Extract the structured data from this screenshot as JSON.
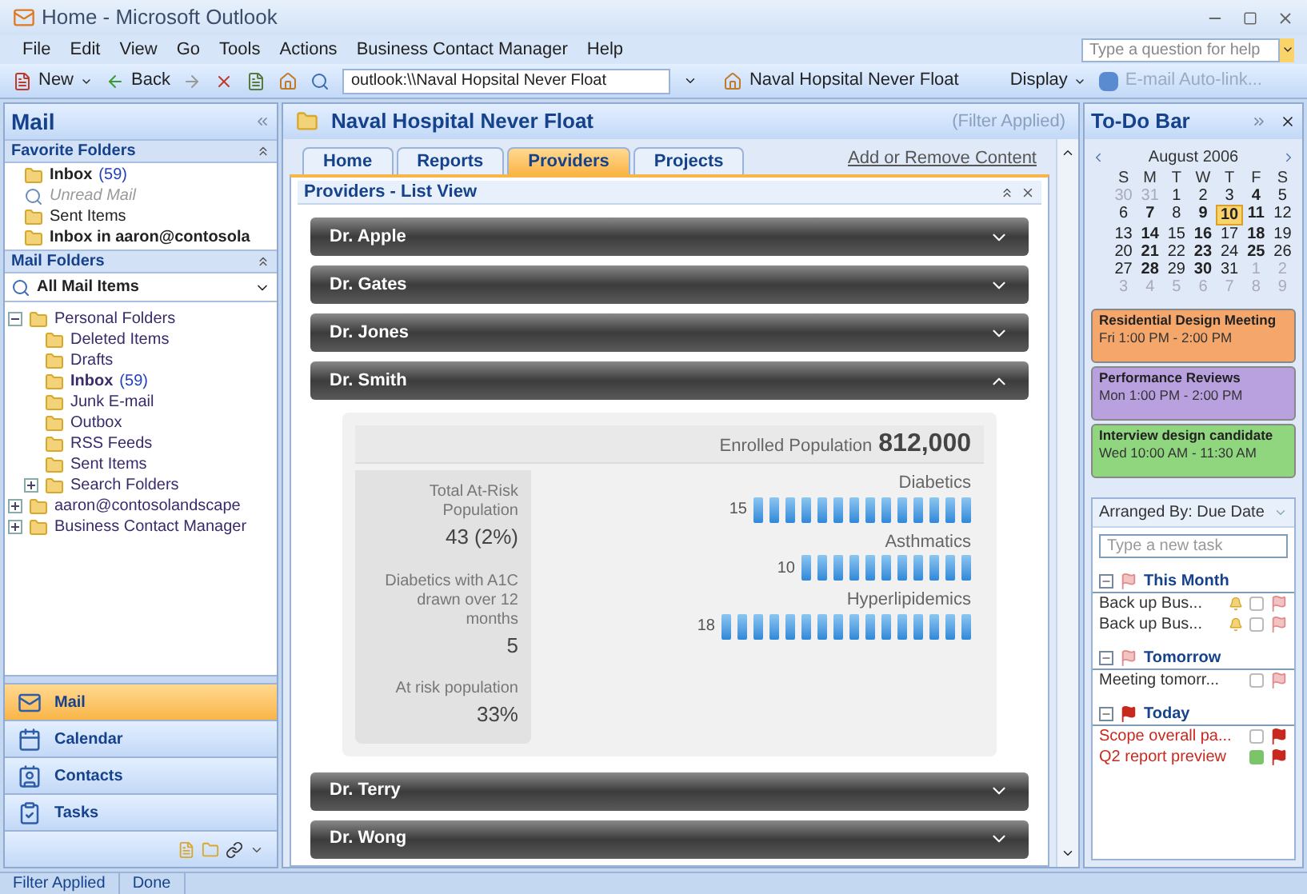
{
  "window": {
    "title": "Home - Microsoft Outlook"
  },
  "menu": [
    "File",
    "Edit",
    "View",
    "Go",
    "Tools",
    "Actions",
    "Business Contact Manager",
    "Help"
  ],
  "help_search": {
    "placeholder": "Type a question for help"
  },
  "toolbar": {
    "new": "New",
    "back": "Back",
    "address": "outlook:\\\\Naval Hopsital Never Float",
    "home_link": "Naval Hopsital Never Float",
    "display": "Display",
    "autolink": {
      "label": "E-mail Auto-link...",
      "disabled": true
    }
  },
  "nav_pane": {
    "title": "Mail",
    "favorites_title": "Favorite Folders",
    "favorites": [
      {
        "label": "Inbox",
        "count": "(59)",
        "kind": "folder",
        "bold": true
      },
      {
        "label": "Unread Mail",
        "kind": "search",
        "bold": false
      },
      {
        "label": "Sent Items",
        "kind": "folder",
        "bold": false
      },
      {
        "label": "Inbox in aaron@contosola",
        "kind": "folder",
        "bold": true
      }
    ],
    "folders_title": "Mail Folders",
    "view": "All Mail Items",
    "tree": [
      {
        "label": "Personal Folders",
        "expanded": true,
        "children": [
          {
            "label": "Deleted Items"
          },
          {
            "label": "Drafts"
          },
          {
            "label": "Inbox",
            "count": "(59)",
            "bold": true
          },
          {
            "label": "Junk E-mail"
          },
          {
            "label": "Outbox"
          },
          {
            "label": "RSS Feeds"
          },
          {
            "label": "Sent Items"
          },
          {
            "label": "Search Folders",
            "expanded": false
          }
        ]
      },
      {
        "label": "aaron@contosolandscape",
        "expanded": false
      },
      {
        "label": "Business Contact Manager",
        "expanded": false
      }
    ],
    "buttons": [
      {
        "label": "Mail",
        "selected": true
      },
      {
        "label": "Calendar",
        "selected": false
      },
      {
        "label": "Contacts",
        "selected": false
      },
      {
        "label": "Tasks",
        "selected": false
      }
    ]
  },
  "content": {
    "title": "Naval Hospital Never Float",
    "filter": "(Filter Applied)",
    "tabs": [
      {
        "label": "Home",
        "selected": false
      },
      {
        "label": "Reports",
        "selected": false
      },
      {
        "label": "Providers",
        "selected": true
      },
      {
        "label": "Projects",
        "selected": false
      }
    ],
    "add_remove": "Add or Remove Content",
    "panel_title": "Providers - List View",
    "providers": [
      {
        "name": "Dr. Apple",
        "expanded": false
      },
      {
        "name": "Dr. Gates",
        "expanded": false
      },
      {
        "name": "Dr. Jones",
        "expanded": false
      },
      {
        "name": "Dr. Smith",
        "expanded": true,
        "detail": {
          "enrolled_label": "Enrolled Population",
          "enrolled_value": "812,000",
          "stats": [
            {
              "label": "Total At-Risk Population",
              "value": "43 (2%)"
            },
            {
              "label": "Diabetics with A1C drawn over 12 months",
              "value": "5"
            },
            {
              "label": "At risk population",
              "value": "33%"
            }
          ],
          "meters": [
            {
              "label": "Diabetics",
              "reading": "15"
            },
            {
              "label": "Asthmatics",
              "reading": "10"
            },
            {
              "label": "Hyperlipidemics",
              "reading": "18"
            }
          ]
        }
      },
      {
        "name": "Dr. Terry",
        "expanded": false
      },
      {
        "name": "Dr. Wong",
        "expanded": false
      }
    ]
  },
  "todo": {
    "title": "To-Do Bar",
    "month": "August 2006",
    "weekdays": [
      "S",
      "M",
      "T",
      "W",
      "T",
      "F",
      "S"
    ],
    "weeks": [
      [
        {
          "d": "30",
          "muted": true,
          "bold": false,
          "selected": false
        },
        {
          "d": "31",
          "muted": true,
          "bold": false,
          "selected": false
        },
        {
          "d": "1",
          "muted": false,
          "bold": false,
          "selected": false
        },
        {
          "d": "2",
          "muted": false,
          "bold": false,
          "selected": false
        },
        {
          "d": "3",
          "muted": false,
          "bold": false,
          "selected": false
        },
        {
          "d": "4",
          "muted": false,
          "bold": true,
          "selected": false
        },
        {
          "d": "5",
          "muted": false,
          "bold": false,
          "selected": false
        }
      ],
      [
        {
          "d": "6",
          "muted": false,
          "bold": false,
          "selected": false
        },
        {
          "d": "7",
          "muted": false,
          "bold": true,
          "selected": false
        },
        {
          "d": "8",
          "muted": false,
          "bold": false,
          "selected": false
        },
        {
          "d": "9",
          "muted": false,
          "bold": true,
          "selected": false
        },
        {
          "d": "10",
          "muted": false,
          "bold": true,
          "selected": true
        },
        {
          "d": "11",
          "muted": false,
          "bold": true,
          "selected": false
        },
        {
          "d": "12",
          "muted": false,
          "bold": false,
          "selected": false
        }
      ],
      [
        {
          "d": "13",
          "muted": false,
          "bold": false,
          "selected": false
        },
        {
          "d": "14",
          "muted": false,
          "bold": true,
          "selected": false
        },
        {
          "d": "15",
          "muted": false,
          "bold": false,
          "selected": false
        },
        {
          "d": "16",
          "muted": false,
          "bold": true,
          "selected": false
        },
        {
          "d": "17",
          "muted": false,
          "bold": false,
          "selected": false
        },
        {
          "d": "18",
          "muted": false,
          "bold": true,
          "selected": false
        },
        {
          "d": "19",
          "muted": false,
          "bold": false,
          "selected": false
        }
      ],
      [
        {
          "d": "20",
          "muted": false,
          "bold": false,
          "selected": false
        },
        {
          "d": "21",
          "muted": false,
          "bold": true,
          "selected": false
        },
        {
          "d": "22",
          "muted": false,
          "bold": false,
          "selected": false
        },
        {
          "d": "23",
          "muted": false,
          "bold": true,
          "selected": false
        },
        {
          "d": "24",
          "muted": false,
          "bold": false,
          "selected": false
        },
        {
          "d": "25",
          "muted": false,
          "bold": true,
          "selected": false
        },
        {
          "d": "26",
          "muted": false,
          "bold": false,
          "selected": false
        }
      ],
      [
        {
          "d": "27",
          "muted": false,
          "bold": false,
          "selected": false
        },
        {
          "d": "28",
          "muted": false,
          "bold": true,
          "selected": false
        },
        {
          "d": "29",
          "muted": false,
          "bold": false,
          "selected": false
        },
        {
          "d": "30",
          "muted": false,
          "bold": true,
          "selected": false
        },
        {
          "d": "31",
          "muted": false,
          "bold": false,
          "selected": false
        },
        {
          "d": "1",
          "muted": true,
          "bold": false,
          "selected": false
        },
        {
          "d": "2",
          "muted": true,
          "bold": false,
          "selected": false
        }
      ],
      [
        {
          "d": "3",
          "muted": true,
          "bold": false,
          "selected": false
        },
        {
          "d": "4",
          "muted": true,
          "bold": false,
          "selected": false
        },
        {
          "d": "5",
          "muted": true,
          "bold": false,
          "selected": false
        },
        {
          "d": "6",
          "muted": true,
          "bold": false,
          "selected": false
        },
        {
          "d": "7",
          "muted": true,
          "bold": false,
          "selected": false
        },
        {
          "d": "8",
          "muted": true,
          "bold": false,
          "selected": false
        },
        {
          "d": "9",
          "muted": true,
          "bold": false,
          "selected": false
        }
      ]
    ],
    "appointments": [
      {
        "title": "Residential Design Meeting",
        "time": "Fri 1:00 PM - 2:00 PM",
        "color": "#f5a66a"
      },
      {
        "title": "Performance Reviews",
        "time": "Mon 1:00 PM - 2:00 PM",
        "color": "#b9a1e0"
      },
      {
        "title": "Interview design candidate",
        "time": "Wed 10:00 AM - 11:30 AM",
        "color": "#8fd67f"
      }
    ],
    "arranged_by": "Arranged By: Due Date",
    "new_task": {
      "placeholder": "Type a new task"
    },
    "groups": [
      {
        "label": "This Month",
        "tasks": [
          {
            "text": "Back up Bus...",
            "reminder": true,
            "overdue": false,
            "done": false
          },
          {
            "text": "Back up Bus...",
            "reminder": true,
            "overdue": false,
            "done": false
          }
        ]
      },
      {
        "label": "Tomorrow",
        "tasks": [
          {
            "text": "Meeting tomorr...",
            "reminder": false,
            "overdue": false,
            "done": false
          }
        ]
      },
      {
        "label": "Today",
        "tasks": [
          {
            "text": "Scope overall pa...",
            "reminder": false,
            "overdue": true,
            "done": false
          },
          {
            "text": "Q2 report preview",
            "reminder": false,
            "overdue": true,
            "color": "#7cc46a"
          }
        ]
      }
    ]
  },
  "status_bar": [
    "Filter Applied",
    "Done"
  ]
}
